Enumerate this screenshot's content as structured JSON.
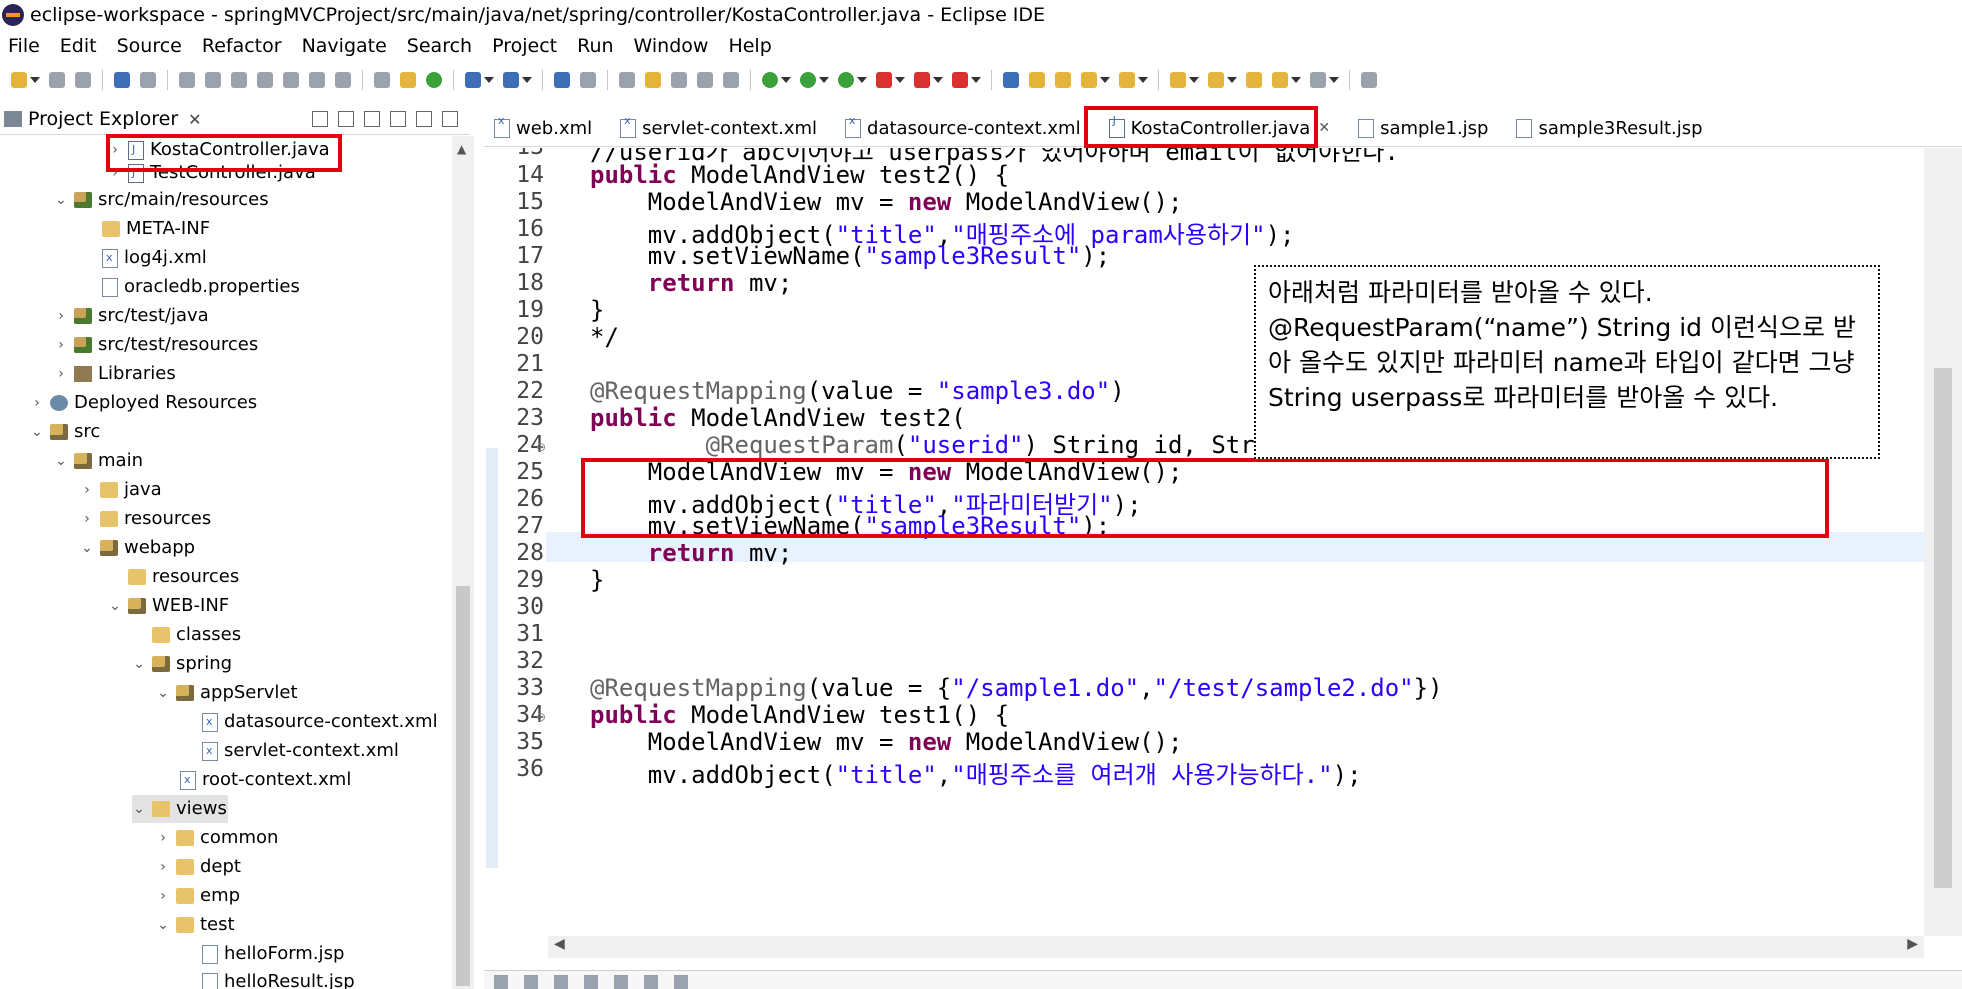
{
  "window": {
    "title": "eclipse-workspace - springMVCProject/src/main/java/net/spring/controller/KostaController.java - Eclipse IDE"
  },
  "menu": [
    "File",
    "Edit",
    "Source",
    "Refactor",
    "Navigate",
    "Search",
    "Project",
    "Run",
    "Window",
    "Help"
  ],
  "project_explorer": {
    "title": "Project Explorer",
    "items": [
      {
        "label": "KostaController.java"
      },
      {
        "label": "TestController.java"
      },
      {
        "label": "src/main/resources"
      },
      {
        "label": "META-INF"
      },
      {
        "label": "log4j.xml"
      },
      {
        "label": "oracledb.properties"
      },
      {
        "label": "src/test/java"
      },
      {
        "label": "src/test/resources"
      },
      {
        "label": "Libraries"
      },
      {
        "label": "Deployed Resources"
      },
      {
        "label": "src"
      },
      {
        "label": "main"
      },
      {
        "label": "java"
      },
      {
        "label": "resources"
      },
      {
        "label": "webapp"
      },
      {
        "label": "resources"
      },
      {
        "label": "WEB-INF"
      },
      {
        "label": "classes"
      },
      {
        "label": "spring"
      },
      {
        "label": "appServlet"
      },
      {
        "label": "datasource-context.xml"
      },
      {
        "label": "servlet-context.xml"
      },
      {
        "label": "root-context.xml"
      },
      {
        "label": "views"
      },
      {
        "label": "common"
      },
      {
        "label": "dept"
      },
      {
        "label": "emp"
      },
      {
        "label": "test"
      },
      {
        "label": "helloForm.jsp"
      },
      {
        "label": "helloResult.jsp"
      }
    ]
  },
  "editor": {
    "tabs": [
      {
        "label": "web.xml"
      },
      {
        "label": "servlet-context.xml"
      },
      {
        "label": "datasource-context.xml"
      },
      {
        "label": "KostaController.java"
      },
      {
        "label": "sample1.jsp"
      },
      {
        "label": "sample3Result.jsp"
      }
    ],
    "active_tab": "KostaController.java",
    "lines": [
      {
        "n": "13",
        "text": "//userid가 abc이어야고 userpass가 있어야하며 email이 없어야한다."
      },
      {
        "n": "14",
        "text": "public ModelAndView test2() {"
      },
      {
        "n": "15",
        "text": "    ModelAndView mv = new ModelAndView();"
      },
      {
        "n": "16",
        "text": "    mv.addObject(\"title\",\"매핑주소에 param사용하기\");"
      },
      {
        "n": "17",
        "text": "    mv.setViewName(\"sample3Result\");"
      },
      {
        "n": "18",
        "text": "    return mv;"
      },
      {
        "n": "19",
        "text": "}"
      },
      {
        "n": "20",
        "text": "*/"
      },
      {
        "n": "21",
        "text": ""
      },
      {
        "n": "22",
        "text": "@RequestMapping(value = \"sample3.do\")"
      },
      {
        "n": "23",
        "text": "public ModelAndView test2("
      },
      {
        "n": "24",
        "text": "        @RequestParam(\"userid\") String id, String userpass, String email) {"
      },
      {
        "n": "25",
        "text": "    ModelAndView mv = new ModelAndView();"
      },
      {
        "n": "26",
        "text": "    mv.addObject(\"title\",\"파라미터받기\");"
      },
      {
        "n": "27",
        "text": "    mv.setViewName(\"sample3Result\");"
      },
      {
        "n": "28",
        "text": "    return mv;"
      },
      {
        "n": "29",
        "text": "}"
      },
      {
        "n": "30",
        "text": ""
      },
      {
        "n": "31",
        "text": ""
      },
      {
        "n": "32",
        "text": ""
      },
      {
        "n": "33",
        "text": "@RequestMapping(value = {\"/sample1.do\",\"/test/sample2.do\"})"
      },
      {
        "n": "34",
        "text": "public ModelAndView test1() {"
      },
      {
        "n": "35",
        "text": "    ModelAndView mv = new ModelAndView();"
      },
      {
        "n": "36",
        "text": "    mv.addObject(\"title\",\"매핑주소를 여러개 사용가능하다.\");"
      }
    ]
  },
  "annotation_note": "아래처럼 파라미터를 받아올 수 있다.\n@RequestParam(“name”) String id 이런식으로 받아 올수도 있지만 파라미터 name과 타입이 같다면 그냥 String userpass로 파라미터를 받아올 수 있다.",
  "colors": {
    "highlight": "#e3000f",
    "keyword": "#7f0055",
    "string": "#2a00ff",
    "current_line": "#e8f2fe"
  }
}
